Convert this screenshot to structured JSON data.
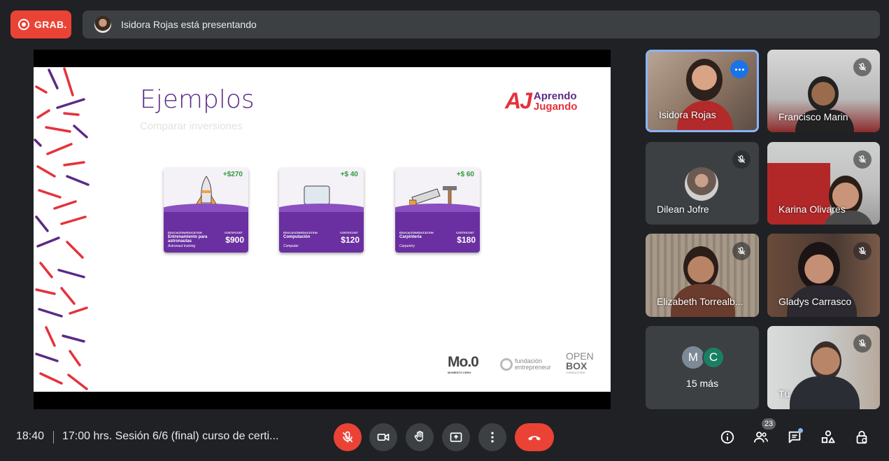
{
  "recording": {
    "label": "GRAB."
  },
  "presenting": {
    "text": "Isidora Rojas está presentando"
  },
  "slide": {
    "title": "Ejemplos",
    "subtitle": "Comparar inversiones",
    "brand_mark": "AJ",
    "brand_line1": "Aprendo",
    "brand_line2": "Jugando",
    "cards": [
      {
        "gain": "+$270",
        "category": "EDUCACIÓN/EDUCATION",
        "name": "Entrenamiento para astronautas",
        "name_en": "Astronaut training",
        "cost_label": "COSTE/COST",
        "price": "$900"
      },
      {
        "gain": "+$ 40",
        "category": "EDUCACIÓN/EDUCATION",
        "name": "Computación",
        "name_en": "Computer",
        "cost_label": "COSTE/COST",
        "price": "$120"
      },
      {
        "gain": "+$ 60",
        "category": "EDUCACIÓN/EDUCATION",
        "name": "Carpintería",
        "name_en": "Carpentry",
        "cost_label": "COSTE/COST",
        "price": "$180"
      }
    ],
    "sponsors": {
      "moo": "Mo.0",
      "moo_sub": "MOMENTO CERO",
      "fundacion_line1": "fundación",
      "fundacion_line2": "entrepreneur",
      "openbox_line1": "OPEN",
      "openbox_line2": "BOX",
      "openbox_line3": "CONSULTORA"
    }
  },
  "participants": [
    {
      "name": "Isidora Rojas",
      "muted": false,
      "speaking": true
    },
    {
      "name": "Francisco Marin",
      "muted": true
    },
    {
      "name": "Dilean Jofre",
      "muted": true
    },
    {
      "name": "Karina Olivares",
      "muted": true
    },
    {
      "name": "Elizabeth Torrealb...",
      "muted": true
    },
    {
      "name": "Gladys Carrasco",
      "muted": true
    },
    {
      "name": "Tú",
      "muted": true
    }
  ],
  "more_tile": {
    "initial_1": "M",
    "initial_2": "C",
    "label": "15 más"
  },
  "bottom_bar": {
    "time": "18:40",
    "meeting_title": "17:00 hrs. Sesión 6/6 (final) curso de certi...",
    "participant_count": "23"
  },
  "icons": {
    "mic": "mic-off-icon",
    "camera": "videocam-icon",
    "hand": "raise-hand-icon",
    "present": "present-screen-icon",
    "more": "more-vert-icon",
    "end_call": "call-end-icon",
    "info": "info-icon",
    "people": "people-icon",
    "chat": "chat-icon",
    "activities": "activities-icon",
    "host": "host-controls-icon"
  },
  "colors": {
    "background": "#202124",
    "tile": "#3c4043",
    "red": "#ea4335",
    "blue": "#1a73e8",
    "brand_purple": "#5b2a86"
  }
}
